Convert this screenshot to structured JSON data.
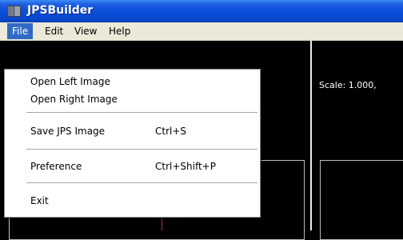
{
  "window": {
    "title": "JPSBuilder"
  },
  "menubar": {
    "items": [
      {
        "label": "File"
      },
      {
        "label": "Edit"
      },
      {
        "label": "View"
      },
      {
        "label": "Help"
      }
    ]
  },
  "file_menu": {
    "open_left": {
      "label": "Open Left Image"
    },
    "open_right": {
      "label": "Open Right Image"
    },
    "save": {
      "label": "Save JPS Image",
      "shortcut": "Ctrl+S"
    },
    "preference": {
      "label": "Preference",
      "shortcut": "Ctrl+Shift+P"
    },
    "exit": {
      "label": "Exit"
    }
  },
  "canvas": {
    "scale_text": "Scale: 1.000,"
  },
  "icons": {
    "app": "app-window-icon"
  }
}
